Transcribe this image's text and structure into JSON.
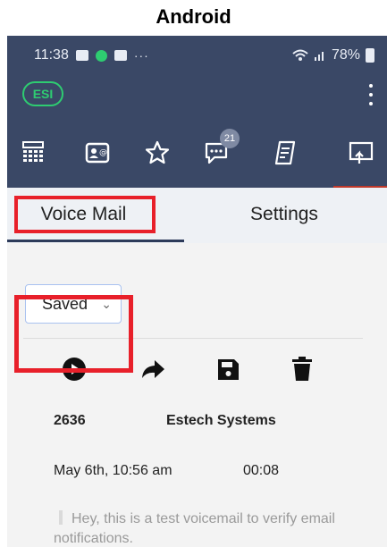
{
  "caption": "Android",
  "status_bar": {
    "time": "11:38",
    "more": "···",
    "battery": "78%"
  },
  "app_bar": {
    "badge": "ESI"
  },
  "icon_bar": {
    "items": [
      "dialpad-icon",
      "contacts-icon",
      "star-icon",
      "chat-icon",
      "notes-icon",
      "share-icon"
    ],
    "chat_badge": "21"
  },
  "tabs": {
    "voicemail": "Voice Mail",
    "settings": "Settings"
  },
  "folder_select": {
    "value": "Saved"
  },
  "voicemail": {
    "extension": "2636",
    "name": "Estech Systems",
    "date": "May 6th, 10:56 am",
    "duration": "00:08",
    "transcript": "Hey, this is a test voicemail to verify email notifications."
  },
  "colors": {
    "header_bg": "#3a4866",
    "accent_green": "#2ecc71",
    "highlight_red": "#e8202a"
  }
}
